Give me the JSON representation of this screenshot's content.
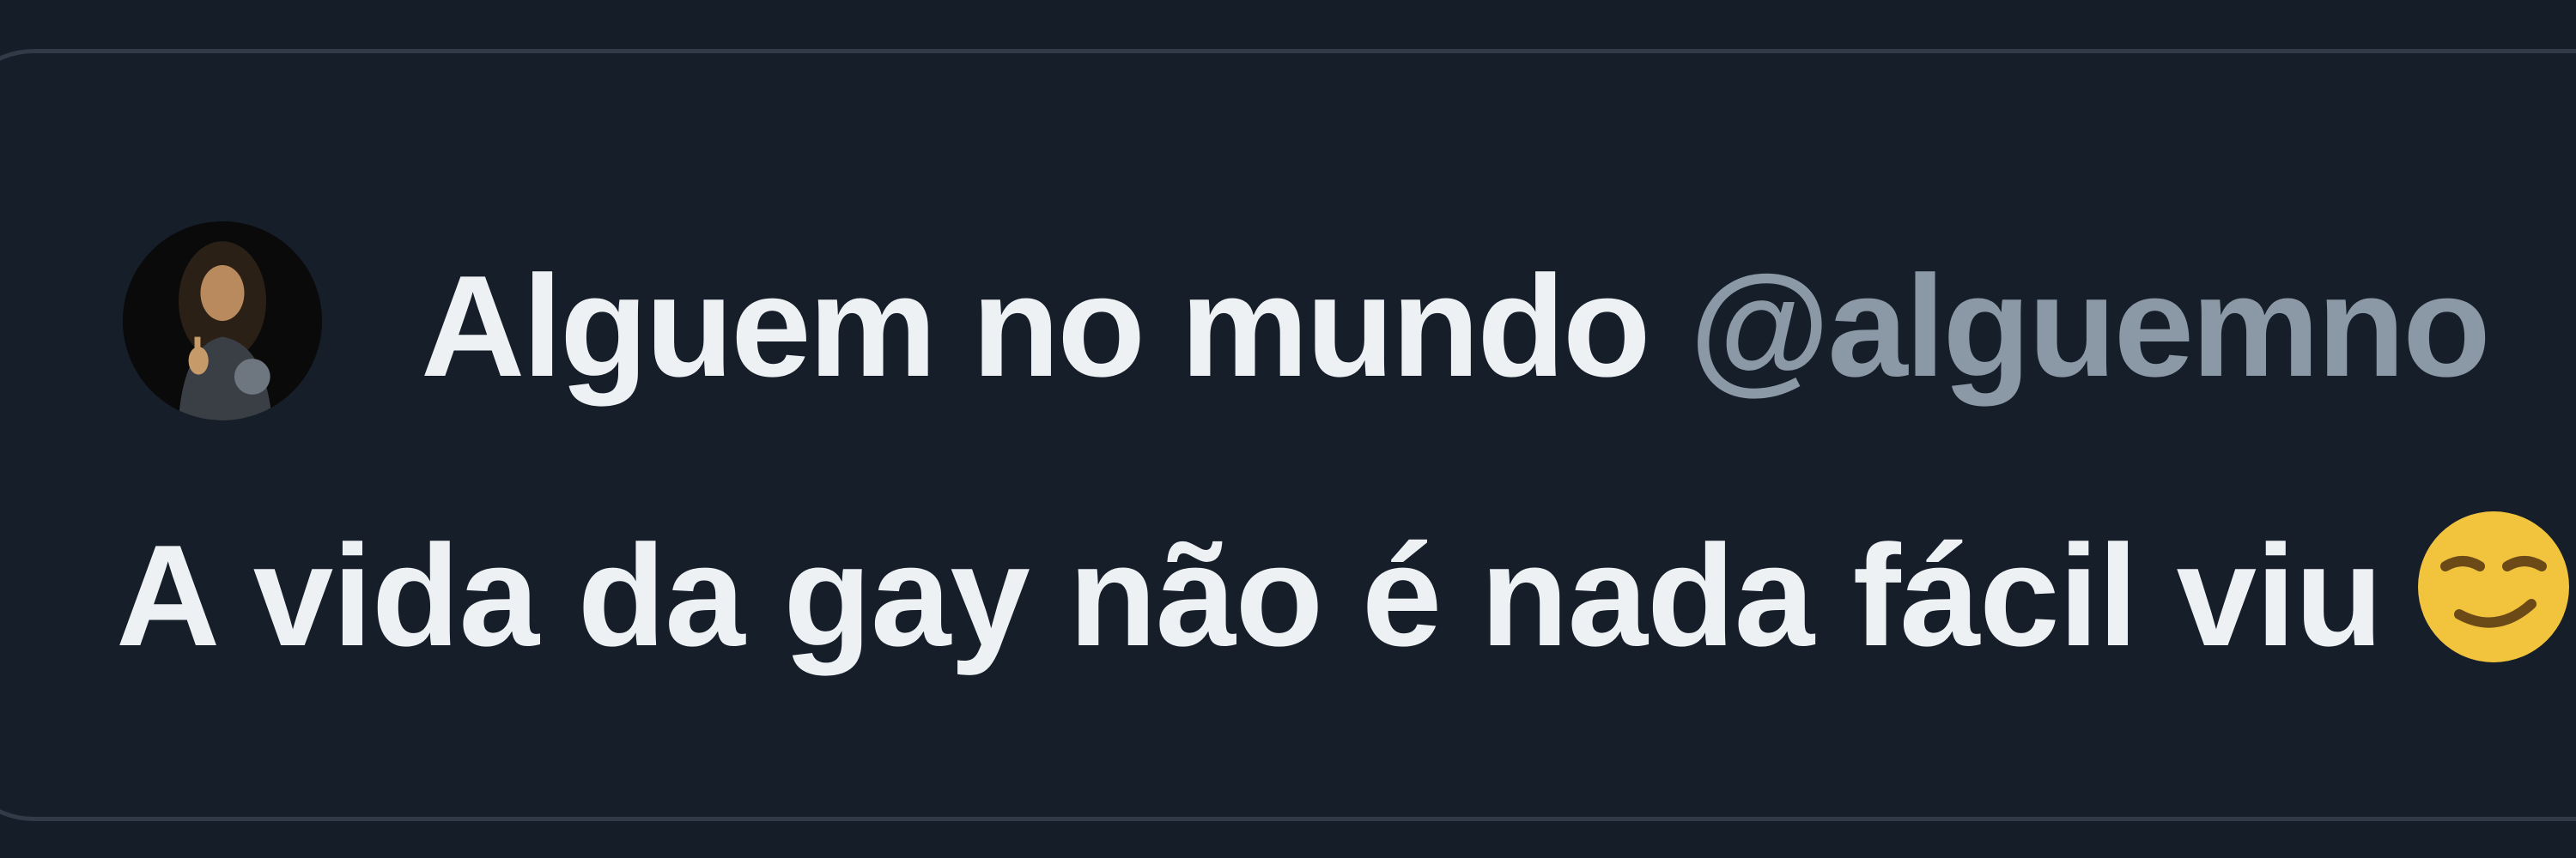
{
  "tweet": {
    "author_name": "Alguem no mundo",
    "author_handle": "@alguemno",
    "text": "A vida da gay não é nada fácil viu",
    "avatar_icon": "painting-portrait-avatar",
    "emoji_icon": "smirk-emoji-icon"
  },
  "colors": {
    "background": "#151d29",
    "card_border": "#313b47",
    "name": "#eef1f4",
    "handle": "#8b98a5",
    "emoji": "#f2c33c"
  }
}
